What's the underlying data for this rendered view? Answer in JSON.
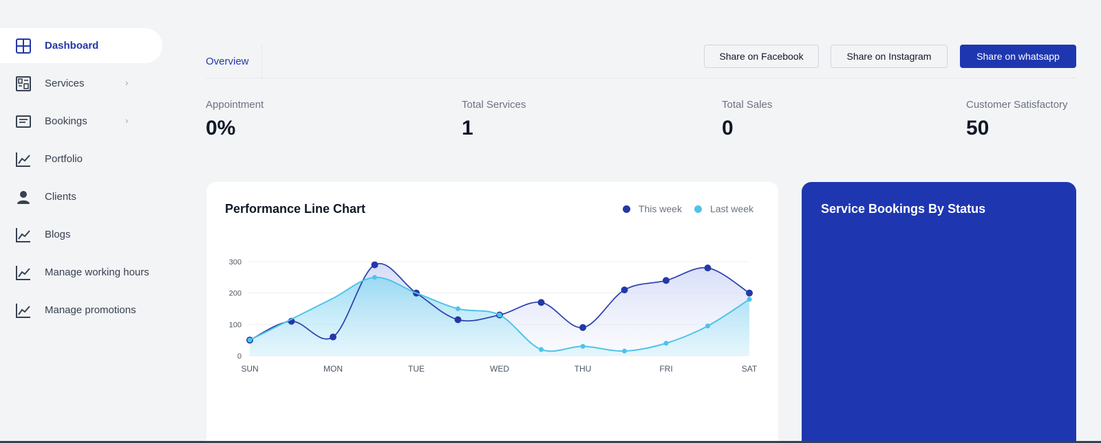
{
  "sidebar": {
    "items": [
      {
        "label": "Dashboard",
        "icon": "grid-icon",
        "active": true
      },
      {
        "label": "Services",
        "icon": "layout-icon",
        "chevron": "›"
      },
      {
        "label": "Bookings",
        "icon": "list-box-icon",
        "chevron": "›"
      },
      {
        "label": "Portfolio",
        "icon": "line-chart-icon"
      },
      {
        "label": "Clients",
        "icon": "person-icon"
      },
      {
        "label": "Blogs",
        "icon": "line-chart-icon"
      },
      {
        "label": "Manage working hours",
        "icon": "line-chart-icon"
      },
      {
        "label": "Manage promotions",
        "icon": "line-chart-icon"
      }
    ]
  },
  "tabs": {
    "overview": "Overview"
  },
  "actions": {
    "facebook": "Share on Facebook",
    "instagram": "Share on Instagram",
    "whatsapp": "Share on whatsapp"
  },
  "stats": [
    {
      "label": "Appointment",
      "value": "0%"
    },
    {
      "label": "Total Services",
      "value": "1"
    },
    {
      "label": "Total Sales",
      "value": "0"
    },
    {
      "label": "Customer Satisfactory",
      "value": "50"
    }
  ],
  "performance": {
    "title": "Performance Line Chart",
    "legend": [
      {
        "name": "This week",
        "color": "#2438a8"
      },
      {
        "name": "Last week",
        "color": "#4fc3e8"
      }
    ]
  },
  "status_card": {
    "title": "Service Bookings By Status"
  },
  "colors": {
    "primary": "#1e37b0",
    "accent": "#4fc3e8"
  },
  "chart_data": {
    "type": "line",
    "categories": [
      "SUN",
      "MON",
      "TUE",
      "WED",
      "THU",
      "FRI",
      "SAT"
    ],
    "x": [
      0,
      0.5,
      1,
      1.5,
      2,
      2.5,
      3,
      3.5,
      4,
      4.5,
      5,
      5.5,
      6
    ],
    "ylim": [
      0,
      300
    ],
    "yticks": [
      0,
      100,
      200,
      300
    ],
    "series": [
      {
        "name": "This week",
        "values": [
          50,
          110,
          60,
          290,
          200,
          115,
          130,
          170,
          90,
          210,
          240,
          280,
          200
        ]
      },
      {
        "name": "Last week",
        "values": [
          50,
          null,
          null,
          250,
          null,
          150,
          130,
          20,
          30,
          15,
          40,
          95,
          180
        ]
      }
    ]
  }
}
